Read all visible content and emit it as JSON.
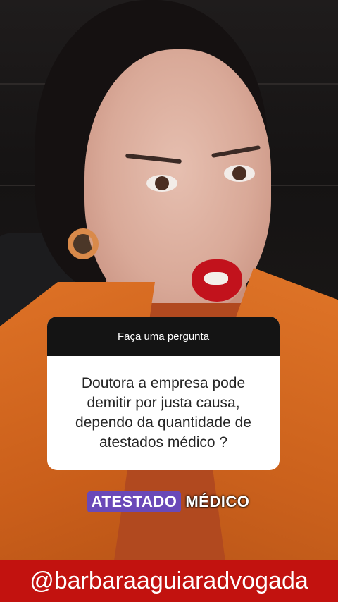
{
  "question": {
    "header": "Faça uma pergunta",
    "text": "Doutora a empresa pode demitir por justa causa, dependo da quantidade de atestados médico ?"
  },
  "caption": {
    "highlight": "ATESTADO",
    "rest": "MÉDICO"
  },
  "handle": "@barbaraaguiaradvogada",
  "colors": {
    "caption_highlight": "#6a49b8",
    "handle_bar": "#c2120f",
    "question_header_bg": "#141414"
  }
}
